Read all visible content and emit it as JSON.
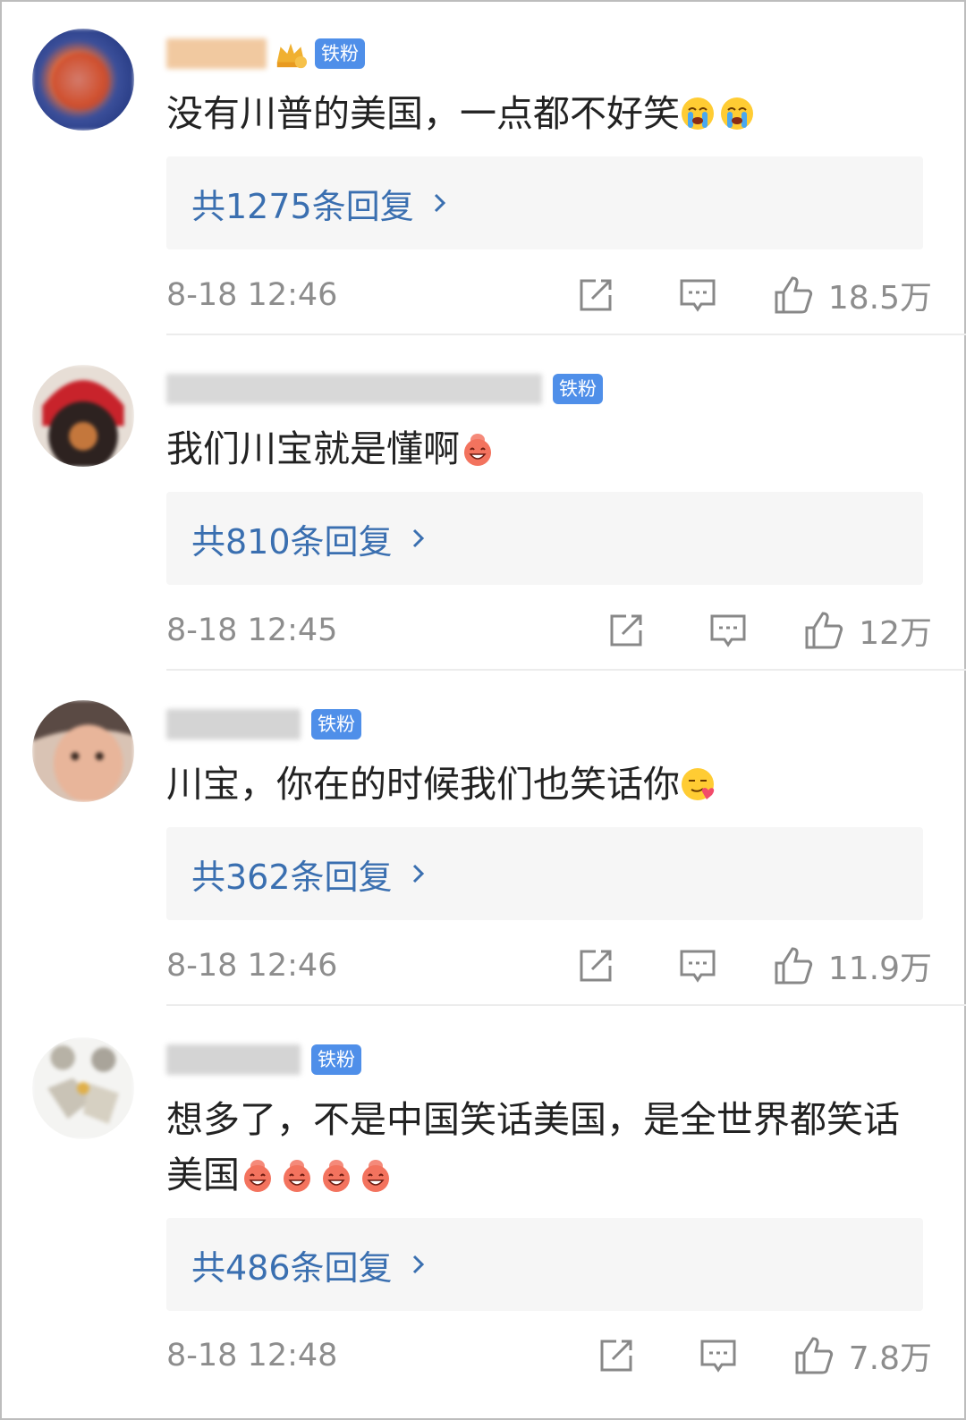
{
  "comments": [
    {
      "badge": "铁粉",
      "vip": true,
      "text": "没有川普的美国，一点都不好笑",
      "emojis": [
        "crying-emoji",
        "crying-emoji"
      ],
      "replies_label": "共1275条回复",
      "time": "8-18 12:46",
      "likes": "18.5万"
    },
    {
      "badge": "铁粉",
      "vip": false,
      "text": "我们川宝就是懂啊",
      "emojis": [
        "laughing-emoji"
      ],
      "replies_label": "共810条回复",
      "time": "8-18 12:45",
      "likes": "12万"
    },
    {
      "badge": "铁粉",
      "vip": false,
      "text": "川宝，你在的时候我们也笑话你",
      "emojis": [
        "smirk-heart-emoji"
      ],
      "replies_label": "共362条回复",
      "time": "8-18 12:46",
      "likes": "11.9万"
    },
    {
      "badge": "铁粉",
      "vip": false,
      "text": "想多了，不是中国笑话美国，是全世界都笑话美国",
      "emojis": [
        "laughing-emoji",
        "laughing-emoji",
        "laughing-emoji",
        "laughing-emoji"
      ],
      "replies_label": "共486条回复",
      "time": "8-18 12:48",
      "likes": "7.8万"
    }
  ],
  "colors": {
    "badge": "#4f8fe9",
    "reply_link": "#3a6fb0",
    "meta_text": "#8d8d8d",
    "reply_box": "#f6f6f6"
  }
}
